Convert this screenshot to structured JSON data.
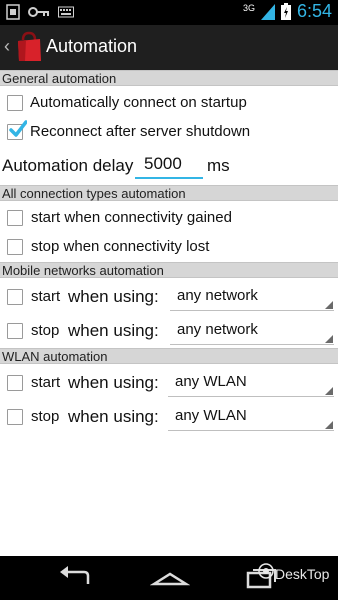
{
  "status_bar": {
    "time": "6:54",
    "network": "3G",
    "icons": [
      "android-debug-icon",
      "key-icon",
      "keyboard-icon",
      "signal-icon",
      "battery-icon"
    ]
  },
  "action_bar": {
    "title": "Automation",
    "icon": "app-bag-icon",
    "back_icon": "chevron-left-icon"
  },
  "general": {
    "header": "General automation",
    "auto_connect_label": "Automatically connect on startup",
    "auto_connect_checked": false,
    "reconnect_label": "Reconnect after server shutdown",
    "reconnect_checked": true,
    "delay_label": "Automation delay",
    "delay_value": "5000",
    "delay_unit": "ms"
  },
  "all_connection": {
    "header": "All connection types automation",
    "start_label": "start when connectivity gained",
    "start_checked": false,
    "stop_label": "stop when connectivity lost",
    "stop_checked": false
  },
  "mobile": {
    "header": "Mobile networks automation",
    "start_label": "start",
    "start_when": "when using:",
    "start_value": "any network",
    "stop_label": "stop",
    "stop_when": "when using:",
    "stop_value": "any network"
  },
  "wlan": {
    "header": "WLAN automation",
    "start_label": "start",
    "start_when": "when using:",
    "start_value": "any WLAN",
    "stop_label": "stop",
    "stop_when": "when using:",
    "stop_value": "any WLAN"
  },
  "nav_bar": {
    "icons": [
      "back-icon",
      "home-icon",
      "recents-icon"
    ]
  },
  "watermark": {
    "text": "DeskTop"
  },
  "colors": {
    "accent": "#33b5e5",
    "action_bar": "#1f1f1f",
    "section_header": "#d6d6d6",
    "app_icon": "#d8222a"
  }
}
